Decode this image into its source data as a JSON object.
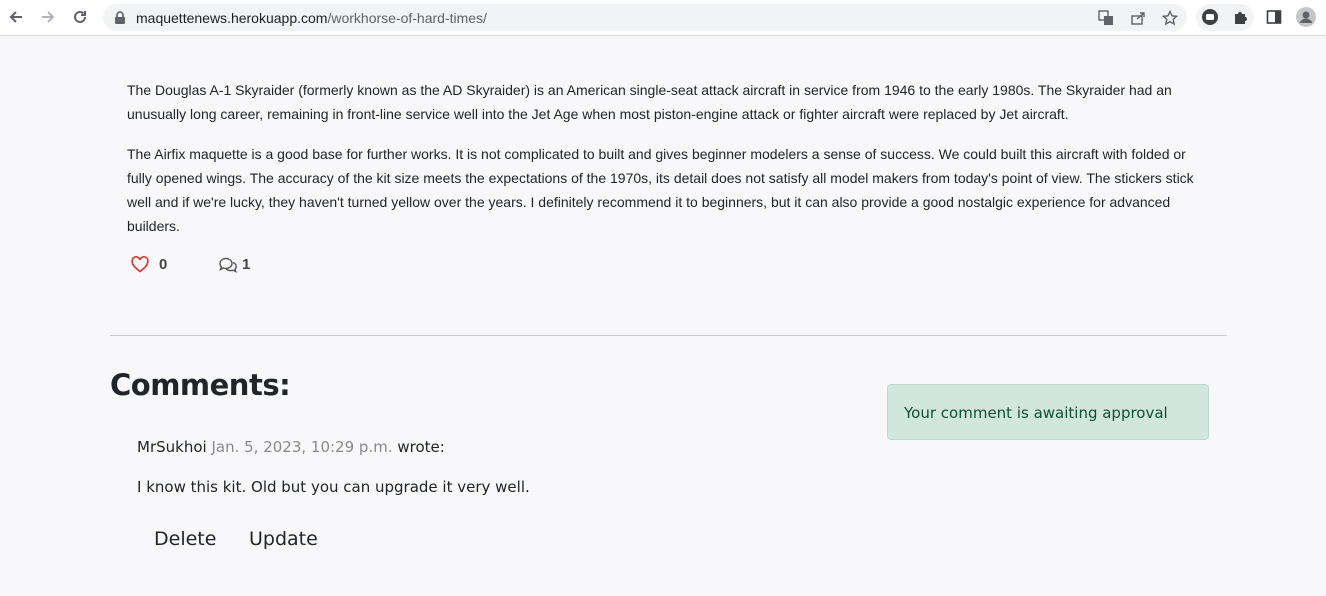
{
  "browser": {
    "url_domain": "maquettenews.herokuapp.com",
    "url_path": "/workhorse-of-hard-times/",
    "icons": [
      "back-icon",
      "forward-icon",
      "reload-icon",
      "lock-icon",
      "translate-icon",
      "share-icon",
      "star-icon",
      "extension-record-icon",
      "puzzle-icon",
      "sidepanel-icon",
      "profile-icon"
    ]
  },
  "article": {
    "paragraphs": [
      "The Douglas A-1 Skyraider (formerly known as the AD Skyraider) is an American single-seat attack aircraft in service from 1946 to the early 1980s. The Skyraider had an unusually long career, remaining in front-line service well into the Jet Age when most piston-engine attack or fighter aircraft were replaced by Jet aircraft.",
      "The Airfix maquette is a good base for further works. It is not complicated to built and gives beginner modelers a sense of success. We could built this aircraft with folded or fully opened wings. The accuracy of the kit size meets the expectations of the 1970s, its detail does not satisfy all model makers from today's point of view. The stickers stick well and if we're lucky, they haven't turned yellow over the years. I definitely recommend it to beginners, but it can also provide a good nostalgic experience for advanced builders."
    ],
    "likes_count": "0",
    "comments_count": "1",
    "like_color": "#d9342b"
  },
  "comments": {
    "title": "Comments:",
    "alert": "Your comment is awaiting approval",
    "items": [
      {
        "author": "MrSukhoi",
        "date": "Jan. 5, 2023, 10:29 p.m.",
        "wrote": "wrote:",
        "body": "I know this kit. Old but you can upgrade it very well."
      }
    ],
    "delete_label": "Delete",
    "update_label": "Update"
  }
}
